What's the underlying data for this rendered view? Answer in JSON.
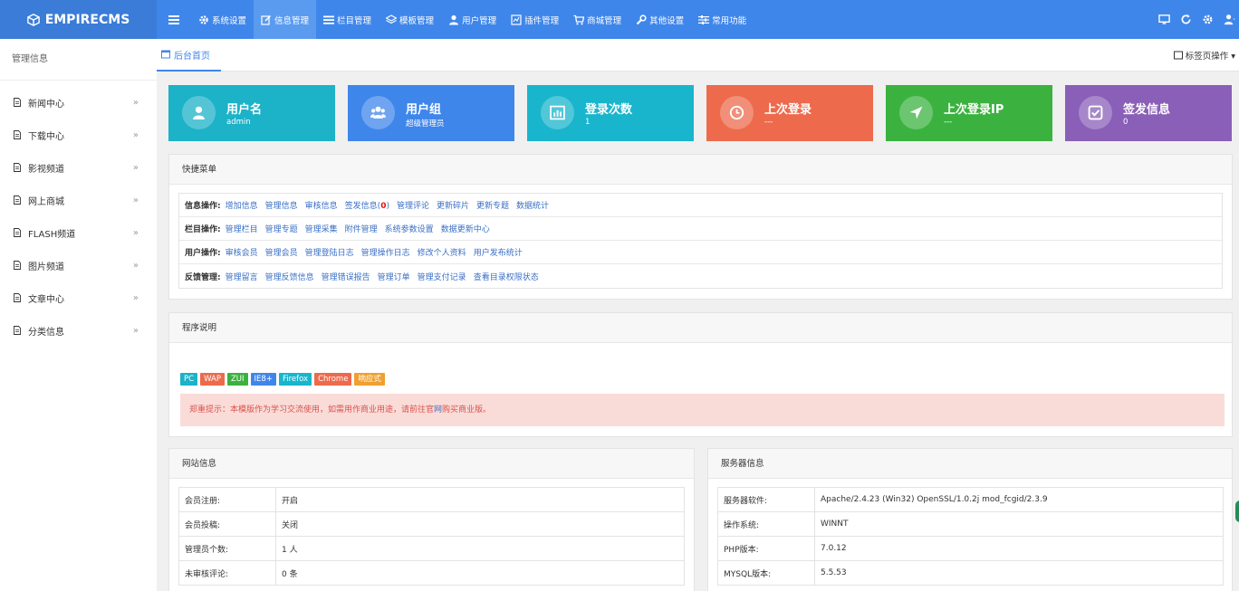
{
  "brand": {
    "name": "EMPIRECMS",
    "icon": "cube-icon"
  },
  "nav": {
    "menu_icon": "menu-icon",
    "items": [
      {
        "label": "系统设置",
        "icon": "gear-icon"
      },
      {
        "label": "信息管理",
        "icon": "edit-icon",
        "active": true
      },
      {
        "label": "栏目管理",
        "icon": "list-icon"
      },
      {
        "label": "模板管理",
        "icon": "layers-icon"
      },
      {
        "label": "用户管理",
        "icon": "user-icon"
      },
      {
        "label": "插件管理",
        "icon": "plugin-icon"
      },
      {
        "label": "商城管理",
        "icon": "cart-icon"
      },
      {
        "label": "其他设置",
        "icon": "wrench-icon"
      },
      {
        "label": "常用功能",
        "icon": "sliders-icon"
      }
    ],
    "right_icons": [
      "desktop-icon",
      "refresh-icon",
      "gear-icon",
      "user-icon"
    ]
  },
  "sidebar": {
    "title": "管理信息",
    "items": [
      {
        "label": "新闻中心"
      },
      {
        "label": "下载中心"
      },
      {
        "label": "影视频道"
      },
      {
        "label": "网上商城"
      },
      {
        "label": "FLASH频道"
      },
      {
        "label": "图片频道"
      },
      {
        "label": "文章中心"
      },
      {
        "label": "分类信息"
      }
    ],
    "arrow": "»"
  },
  "tabs": {
    "home_label": "后台首页",
    "ops_label": "标签页操作 ▾"
  },
  "cards": [
    {
      "title": "用户名",
      "value": "admin",
      "color": "#1cb2c8",
      "icon": "user-icon"
    },
    {
      "title": "用户组",
      "value": "超级管理员",
      "color": "#3f86eb",
      "icon": "users-icon"
    },
    {
      "title": "登录次数",
      "value": "1",
      "color": "#19b5cc",
      "icon": "chart-icon"
    },
    {
      "title": "上次登录",
      "value": "---",
      "color": "#ed6a4c",
      "icon": "clock-icon"
    },
    {
      "title": "上次登录IP",
      "value": "---",
      "color": "#3bb23f",
      "icon": "location-arrow-icon"
    },
    {
      "title": "签发信息",
      "value": "0",
      "color": "#8a5fb8",
      "icon": "check-square-icon"
    }
  ],
  "quick": {
    "title": "快捷菜单",
    "rows": [
      {
        "label": "信息操作:",
        "links": [
          "增加信息",
          "管理信息",
          "审核信息",
          "签发信息",
          "管理评论",
          "更新碎片",
          "更新专题",
          "数据统计"
        ],
        "sign_count": "0"
      },
      {
        "label": "栏目操作:",
        "links": [
          "管理栏目",
          "管理专题",
          "管理采集",
          "附件管理",
          "系统参数设置",
          "数据更新中心"
        ]
      },
      {
        "label": "用户操作:",
        "links": [
          "审核会员",
          "管理会员",
          "管理登陆日志",
          "管理操作日志",
          "修改个人资料",
          "用户发布统计"
        ]
      },
      {
        "label": "反馈管理:",
        "links": [
          "管理留言",
          "管理反馈信息",
          "管理错误报告",
          "管理订单",
          "管理支付记录",
          "查看目录权限状态"
        ]
      }
    ]
  },
  "program": {
    "title": "程序说明",
    "badges": [
      {
        "label": "PC",
        "color": "#1cb2c8"
      },
      {
        "label": "WAP",
        "color": "#ed6a4c"
      },
      {
        "label": "ZUI",
        "color": "#3bb23f"
      },
      {
        "label": "IE8+",
        "color": "#3f86eb"
      },
      {
        "label": "Firefox",
        "color": "#19b5cc"
      },
      {
        "label": "Chrome",
        "color": "#ed6a4c"
      },
      {
        "label": "响应式",
        "color": "#f0a030"
      }
    ],
    "notice_pre": "郑重提示：本模版作为学习交流使用，如需用作商业用途，请前往官",
    "notice_link": "网",
    "notice_post": "购买商业版。"
  },
  "site_info": {
    "title": "网站信息",
    "rows": [
      {
        "key": "会员注册:",
        "value": "开启"
      },
      {
        "key": "会员投稿:",
        "value": "关闭"
      },
      {
        "key": "管理员个数:",
        "value": "1 人"
      },
      {
        "key": "未审核评论:",
        "value": "0 条"
      }
    ]
  },
  "server_info": {
    "title": "服务器信息",
    "rows": [
      {
        "key": "服务器软件:",
        "value": "Apache/2.4.23 (Win32) OpenSSL/1.0.2j mod_fcgid/2.3.9"
      },
      {
        "key": "操作系统:",
        "value": "WINNT"
      },
      {
        "key": "PHP版本:",
        "value": "7.0.12"
      },
      {
        "key": "MYSQL版本:",
        "value": "5.5.53"
      }
    ]
  }
}
